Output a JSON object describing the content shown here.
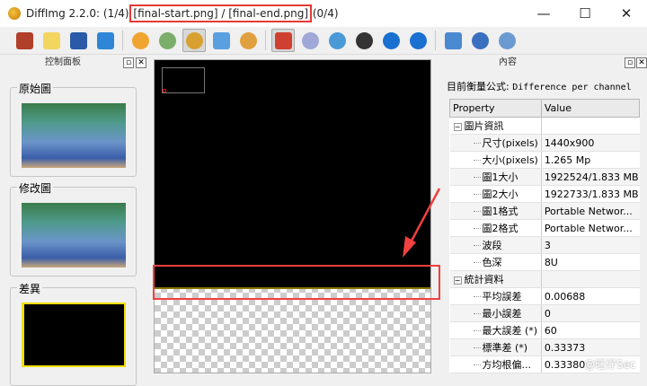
{
  "window": {
    "title_prefix": "DiffImg 2.2.0:  (1/4) ",
    "title_files": "[final-start.png] / [final-end.png]",
    "title_suffix": " (0/4)",
    "minimize": "—",
    "maximize": "☐",
    "close": "✕"
  },
  "toolbar": [
    {
      "name": "quit-icon",
      "color": "#b0402a"
    },
    {
      "name": "open-folder-icon",
      "color": "#f2d660"
    },
    {
      "name": "save-icon",
      "color": "#2a5aa8"
    },
    {
      "name": "refresh-icon",
      "color": "#2f86d6"
    },
    {
      "name": "smiley-icon",
      "color": "#f0a530"
    },
    {
      "name": "alien-icon",
      "color": "#7aae6a"
    },
    {
      "name": "diff-mode-icon",
      "color": "#d8a030"
    },
    {
      "name": "split-view-icon",
      "color": "#5aa0e0"
    },
    {
      "name": "blend-view-icon",
      "color": "#e0a040"
    },
    {
      "name": "settings-icon",
      "color": "#d04030"
    },
    {
      "name": "link-icon",
      "color": "#a0a8d8"
    },
    {
      "name": "zoom-fit-icon",
      "color": "#4a9ad8"
    },
    {
      "name": "zoom-1to1-icon",
      "color": "#333333"
    },
    {
      "name": "previous-icon",
      "color": "#1a70d0"
    },
    {
      "name": "next-icon",
      "color": "#1a70d0"
    },
    {
      "name": "checklist-icon",
      "color": "#4a8ad0"
    },
    {
      "name": "info-icon",
      "color": "#3a70c0"
    },
    {
      "name": "help-icon",
      "color": "#6a9ad0"
    }
  ],
  "left_panel": {
    "title": "控制面板",
    "original_label": "原始圖",
    "modified_label": "修改圖",
    "difference_label": "差異"
  },
  "right_panel": {
    "title": "內容",
    "formula_label": "目前衡量公式: ",
    "formula_value": "Difference per channel",
    "columns": [
      "Property",
      "Value"
    ],
    "sections": [
      {
        "name": "圖片資訊",
        "rows": [
          [
            "尺寸(pixels)",
            "1440x900"
          ],
          [
            "大小(pixels)",
            "1.265 Mp"
          ],
          [
            "圖1大小",
            "1922524/1.833 MB"
          ],
          [
            "圖2大小",
            "1922733/1.833 MB"
          ],
          [
            "圖1格式",
            "Portable Networ..."
          ],
          [
            "圖2格式",
            "Portable Networ..."
          ],
          [
            "波段",
            "3"
          ],
          [
            "色深",
            "8U"
          ]
        ]
      },
      {
        "name": "統計資料",
        "rows": [
          [
            "平均誤差",
            "0.00688"
          ],
          [
            "最小誤差",
            "0"
          ],
          [
            "最大誤差 (*)",
            "60"
          ],
          [
            "標準差 (*)",
            "0.33373"
          ],
          [
            "方均根偏...",
            "0.33380"
          ]
        ]
      }
    ]
  },
  "watermark": "@旺仔Sec",
  "colors": {
    "annotation": "#f04040",
    "diff_line": "#8a7400"
  }
}
